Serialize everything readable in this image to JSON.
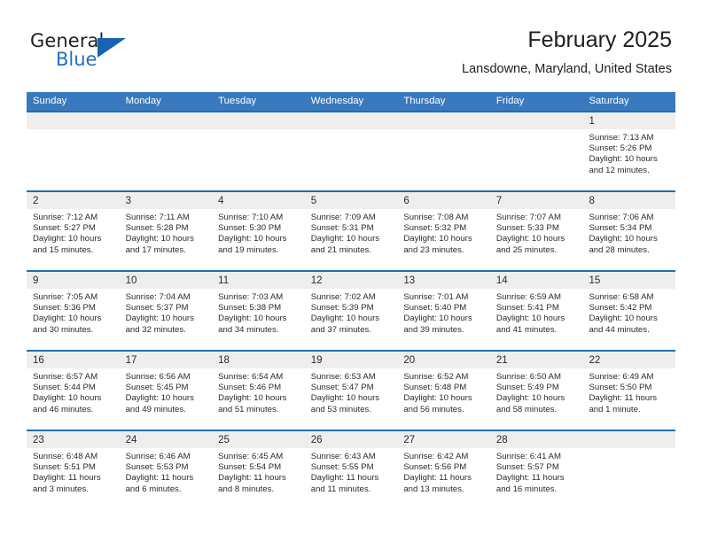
{
  "logo": {
    "primary_text": "General",
    "secondary_text": "Blue",
    "triangle_color": "#1565b0",
    "secondary_color": "#1f6fc4"
  },
  "header": {
    "title": "February 2025",
    "subtitle": "Lansdowne, Maryland, United States"
  },
  "colors": {
    "header_blue": "#3a79bd",
    "row_divider_blue": "#1f6fb2",
    "day_band_gray": "#eeeeee"
  },
  "weekdays": [
    "Sunday",
    "Monday",
    "Tuesday",
    "Wednesday",
    "Thursday",
    "Friday",
    "Saturday"
  ],
  "weeks": [
    [
      {
        "day": "",
        "sunrise": "",
        "sunset": "",
        "daylight_line1": "",
        "daylight_line2": ""
      },
      {
        "day": "",
        "sunrise": "",
        "sunset": "",
        "daylight_line1": "",
        "daylight_line2": ""
      },
      {
        "day": "",
        "sunrise": "",
        "sunset": "",
        "daylight_line1": "",
        "daylight_line2": ""
      },
      {
        "day": "",
        "sunrise": "",
        "sunset": "",
        "daylight_line1": "",
        "daylight_line2": ""
      },
      {
        "day": "",
        "sunrise": "",
        "sunset": "",
        "daylight_line1": "",
        "daylight_line2": ""
      },
      {
        "day": "",
        "sunrise": "",
        "sunset": "",
        "daylight_line1": "",
        "daylight_line2": ""
      },
      {
        "day": "1",
        "sunrise": "Sunrise: 7:13 AM",
        "sunset": "Sunset: 5:26 PM",
        "daylight_line1": "Daylight: 10 hours",
        "daylight_line2": "and 12 minutes."
      }
    ],
    [
      {
        "day": "2",
        "sunrise": "Sunrise: 7:12 AM",
        "sunset": "Sunset: 5:27 PM",
        "daylight_line1": "Daylight: 10 hours",
        "daylight_line2": "and 15 minutes."
      },
      {
        "day": "3",
        "sunrise": "Sunrise: 7:11 AM",
        "sunset": "Sunset: 5:28 PM",
        "daylight_line1": "Daylight: 10 hours",
        "daylight_line2": "and 17 minutes."
      },
      {
        "day": "4",
        "sunrise": "Sunrise: 7:10 AM",
        "sunset": "Sunset: 5:30 PM",
        "daylight_line1": "Daylight: 10 hours",
        "daylight_line2": "and 19 minutes."
      },
      {
        "day": "5",
        "sunrise": "Sunrise: 7:09 AM",
        "sunset": "Sunset: 5:31 PM",
        "daylight_line1": "Daylight: 10 hours",
        "daylight_line2": "and 21 minutes."
      },
      {
        "day": "6",
        "sunrise": "Sunrise: 7:08 AM",
        "sunset": "Sunset: 5:32 PM",
        "daylight_line1": "Daylight: 10 hours",
        "daylight_line2": "and 23 minutes."
      },
      {
        "day": "7",
        "sunrise": "Sunrise: 7:07 AM",
        "sunset": "Sunset: 5:33 PM",
        "daylight_line1": "Daylight: 10 hours",
        "daylight_line2": "and 25 minutes."
      },
      {
        "day": "8",
        "sunrise": "Sunrise: 7:06 AM",
        "sunset": "Sunset: 5:34 PM",
        "daylight_line1": "Daylight: 10 hours",
        "daylight_line2": "and 28 minutes."
      }
    ],
    [
      {
        "day": "9",
        "sunrise": "Sunrise: 7:05 AM",
        "sunset": "Sunset: 5:36 PM",
        "daylight_line1": "Daylight: 10 hours",
        "daylight_line2": "and 30 minutes."
      },
      {
        "day": "10",
        "sunrise": "Sunrise: 7:04 AM",
        "sunset": "Sunset: 5:37 PM",
        "daylight_line1": "Daylight: 10 hours",
        "daylight_line2": "and 32 minutes."
      },
      {
        "day": "11",
        "sunrise": "Sunrise: 7:03 AM",
        "sunset": "Sunset: 5:38 PM",
        "daylight_line1": "Daylight: 10 hours",
        "daylight_line2": "and 34 minutes."
      },
      {
        "day": "12",
        "sunrise": "Sunrise: 7:02 AM",
        "sunset": "Sunset: 5:39 PM",
        "daylight_line1": "Daylight: 10 hours",
        "daylight_line2": "and 37 minutes."
      },
      {
        "day": "13",
        "sunrise": "Sunrise: 7:01 AM",
        "sunset": "Sunset: 5:40 PM",
        "daylight_line1": "Daylight: 10 hours",
        "daylight_line2": "and 39 minutes."
      },
      {
        "day": "14",
        "sunrise": "Sunrise: 6:59 AM",
        "sunset": "Sunset: 5:41 PM",
        "daylight_line1": "Daylight: 10 hours",
        "daylight_line2": "and 41 minutes."
      },
      {
        "day": "15",
        "sunrise": "Sunrise: 6:58 AM",
        "sunset": "Sunset: 5:42 PM",
        "daylight_line1": "Daylight: 10 hours",
        "daylight_line2": "and 44 minutes."
      }
    ],
    [
      {
        "day": "16",
        "sunrise": "Sunrise: 6:57 AM",
        "sunset": "Sunset: 5:44 PM",
        "daylight_line1": "Daylight: 10 hours",
        "daylight_line2": "and 46 minutes."
      },
      {
        "day": "17",
        "sunrise": "Sunrise: 6:56 AM",
        "sunset": "Sunset: 5:45 PM",
        "daylight_line1": "Daylight: 10 hours",
        "daylight_line2": "and 49 minutes."
      },
      {
        "day": "18",
        "sunrise": "Sunrise: 6:54 AM",
        "sunset": "Sunset: 5:46 PM",
        "daylight_line1": "Daylight: 10 hours",
        "daylight_line2": "and 51 minutes."
      },
      {
        "day": "19",
        "sunrise": "Sunrise: 6:53 AM",
        "sunset": "Sunset: 5:47 PM",
        "daylight_line1": "Daylight: 10 hours",
        "daylight_line2": "and 53 minutes."
      },
      {
        "day": "20",
        "sunrise": "Sunrise: 6:52 AM",
        "sunset": "Sunset: 5:48 PM",
        "daylight_line1": "Daylight: 10 hours",
        "daylight_line2": "and 56 minutes."
      },
      {
        "day": "21",
        "sunrise": "Sunrise: 6:50 AM",
        "sunset": "Sunset: 5:49 PM",
        "daylight_line1": "Daylight: 10 hours",
        "daylight_line2": "and 58 minutes."
      },
      {
        "day": "22",
        "sunrise": "Sunrise: 6:49 AM",
        "sunset": "Sunset: 5:50 PM",
        "daylight_line1": "Daylight: 11 hours",
        "daylight_line2": "and 1 minute."
      }
    ],
    [
      {
        "day": "23",
        "sunrise": "Sunrise: 6:48 AM",
        "sunset": "Sunset: 5:51 PM",
        "daylight_line1": "Daylight: 11 hours",
        "daylight_line2": "and 3 minutes."
      },
      {
        "day": "24",
        "sunrise": "Sunrise: 6:46 AM",
        "sunset": "Sunset: 5:53 PM",
        "daylight_line1": "Daylight: 11 hours",
        "daylight_line2": "and 6 minutes."
      },
      {
        "day": "25",
        "sunrise": "Sunrise: 6:45 AM",
        "sunset": "Sunset: 5:54 PM",
        "daylight_line1": "Daylight: 11 hours",
        "daylight_line2": "and 8 minutes."
      },
      {
        "day": "26",
        "sunrise": "Sunrise: 6:43 AM",
        "sunset": "Sunset: 5:55 PM",
        "daylight_line1": "Daylight: 11 hours",
        "daylight_line2": "and 11 minutes."
      },
      {
        "day": "27",
        "sunrise": "Sunrise: 6:42 AM",
        "sunset": "Sunset: 5:56 PM",
        "daylight_line1": "Daylight: 11 hours",
        "daylight_line2": "and 13 minutes."
      },
      {
        "day": "28",
        "sunrise": "Sunrise: 6:41 AM",
        "sunset": "Sunset: 5:57 PM",
        "daylight_line1": "Daylight: 11 hours",
        "daylight_line2": "and 16 minutes."
      },
      {
        "day": "",
        "sunrise": "",
        "sunset": "",
        "daylight_line1": "",
        "daylight_line2": ""
      }
    ]
  ]
}
